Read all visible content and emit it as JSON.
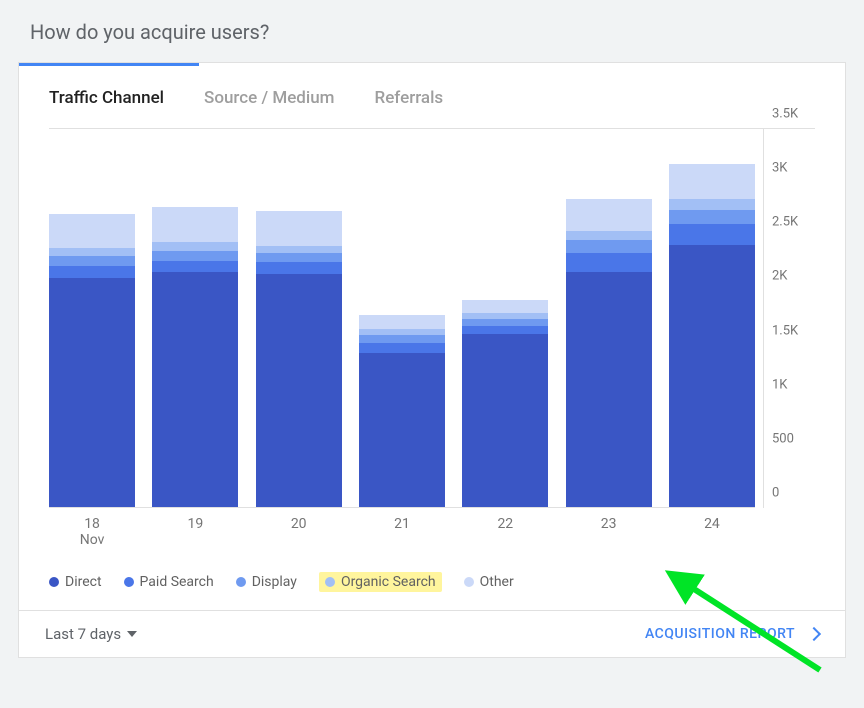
{
  "title": "How do you acquire users?",
  "tabs": [
    {
      "label": "Traffic Channel",
      "active": true
    },
    {
      "label": "Source / Medium",
      "active": false
    },
    {
      "label": "Referrals",
      "active": false
    }
  ],
  "legend": [
    {
      "name": "Direct",
      "color": "#3a56c5"
    },
    {
      "name": "Paid Search",
      "color": "#4a76e8"
    },
    {
      "name": "Display",
      "color": "#6f9af0"
    },
    {
      "name": "Organic Search",
      "color": "#a2bff5",
      "highlight": true
    },
    {
      "name": "Other",
      "color": "#cbd9f8"
    }
  ],
  "footer": {
    "date_range": "Last 7 days",
    "report_link": "ACQUISITION REPORT"
  },
  "chart_data": {
    "type": "bar_stacked",
    "ylabel": "",
    "xlabel": "",
    "ylim": [
      0,
      3500
    ],
    "y_ticks": [
      "0",
      "500",
      "1K",
      "1.5K",
      "2K",
      "2.5K",
      "3K",
      "3.5K"
    ],
    "categories": [
      "18",
      "19",
      "20",
      "21",
      "22",
      "23",
      "24"
    ],
    "x_sublabel": "Nov",
    "series": [
      {
        "name": "Direct",
        "color": "#3a56c5",
        "values": [
          2120,
          2180,
          2160,
          1430,
          1600,
          2180,
          2430
        ]
      },
      {
        "name": "Paid Search",
        "color": "#4a76e8",
        "values": [
          110,
          100,
          110,
          90,
          80,
          170,
          190
        ]
      },
      {
        "name": "Display",
        "color": "#6f9af0",
        "values": [
          90,
          90,
          80,
          70,
          60,
          120,
          130
        ]
      },
      {
        "name": "Organic Search",
        "color": "#a2bff5",
        "values": [
          80,
          80,
          70,
          60,
          60,
          90,
          100
        ]
      },
      {
        "name": "Other",
        "color": "#cbd9f8",
        "values": [
          310,
          330,
          320,
          130,
          120,
          290,
          330
        ]
      }
    ]
  }
}
